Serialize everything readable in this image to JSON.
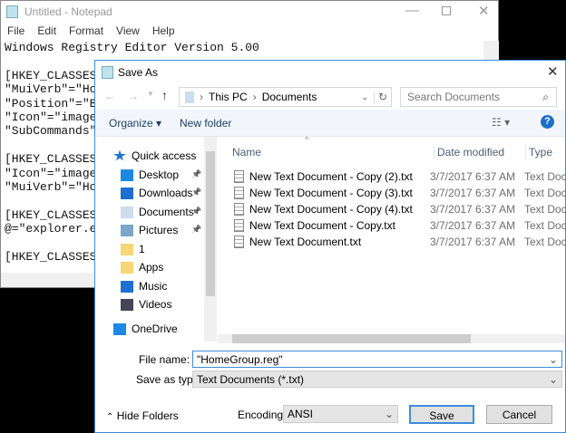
{
  "notepad": {
    "title": "Untitled - Notepad",
    "menu": [
      "File",
      "Edit",
      "Format",
      "View",
      "Help"
    ],
    "lines": [
      "Windows Registry Editor Version 5.00",
      "",
      "[HKEY_CLASSES_R",
      "\"MuiVerb\"=\"Home",
      "\"Position\"=\"Bot",
      "\"Icon\"=\"imagere",
      "\"SubCommands\"=\"",
      "",
      "[HKEY_CLASSES_R",
      "\"Icon\"=\"imagere",
      "\"MuiVerb\"=\"Home",
      "",
      "[HKEY_CLASSES_R",
      "@=\"explorer.exe",
      "",
      "[HKEY_CLASSES_R"
    ]
  },
  "dialog": {
    "title": "Save As",
    "address": {
      "crumbs": [
        "This PC",
        "Documents"
      ]
    },
    "search_placeholder": "Search Documents",
    "toolbar": {
      "organize": "Organize",
      "new_folder": "New folder"
    },
    "sidebar": [
      {
        "label": "Quick access",
        "icon": "star-icon"
      },
      {
        "label": "Desktop",
        "icon": "desktop-icon",
        "pinned": true
      },
      {
        "label": "Downloads",
        "icon": "download-icon",
        "pinned": true
      },
      {
        "label": "Documents",
        "icon": "documents-icon",
        "pinned": true
      },
      {
        "label": "Pictures",
        "icon": "pictures-icon",
        "pinned": true
      },
      {
        "label": "1",
        "icon": "folder-icon"
      },
      {
        "label": "Apps",
        "icon": "folder-icon"
      },
      {
        "label": "Music",
        "icon": "music-icon"
      },
      {
        "label": "Videos",
        "icon": "videos-icon"
      },
      {
        "label": "OneDrive",
        "icon": "cloud-icon"
      }
    ],
    "columns": [
      "Name",
      "Date modified",
      "Type"
    ],
    "files": [
      {
        "name": "New Text Document - Copy (2).txt",
        "date": "3/7/2017 6:37 AM",
        "type": "Text Document"
      },
      {
        "name": "New Text Document - Copy (3).txt",
        "date": "3/7/2017 6:37 AM",
        "type": "Text Document"
      },
      {
        "name": "New Text Document - Copy (4).txt",
        "date": "3/7/2017 6:37 AM",
        "type": "Text Document"
      },
      {
        "name": "New Text Document - Copy.txt",
        "date": "3/7/2017 6:37 AM",
        "type": "Text Document"
      },
      {
        "name": "New Text Document.txt",
        "date": "3/7/2017 6:37 AM",
        "type": "Text Document"
      }
    ],
    "file_name_label": "File name:",
    "file_name": "\"HomeGroup.reg\"",
    "save_type_label": "Save as type:",
    "save_type": "Text Documents (*.txt)",
    "hide_folders": "Hide Folders",
    "encoding_label": "Encoding:",
    "encoding": "ANSI",
    "save": "Save",
    "cancel": "Cancel"
  }
}
